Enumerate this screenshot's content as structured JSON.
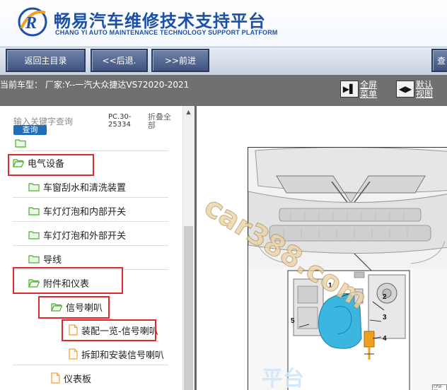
{
  "header": {
    "brand_cn": "畅易汽车维修技术支持平台",
    "brand_en": "CHANG YI AUTO MAINTENANCE TECHNOLOGY SUPPORT PLATFORM",
    "logo_icon": "cy-logo-icon"
  },
  "toolbar": {
    "home_label": "返回主目录",
    "back_label": "<<后退.",
    "forward_label": ">>前进",
    "query_label": "查"
  },
  "infobar": {
    "current_model": "当前车型： 厂家:Y--一汽大众捷达VS72020-2021",
    "fullscreen_label": "全屏菜单",
    "default_view_label": "默认视图"
  },
  "sidebar": {
    "search_label": "输入关键字查询",
    "search_button": "查询",
    "pc_code": "PC.30-25334",
    "fold_all": "折叠全部",
    "items": [
      {
        "label": "电气设备",
        "icon": "folder-icon"
      },
      {
        "label": "车窗刮水和清洗装置",
        "icon": "folder-icon"
      },
      {
        "label": "车灯灯泡和内部开关",
        "icon": "folder-icon"
      },
      {
        "label": "车灯灯泡和外部开关",
        "icon": "folder-icon"
      },
      {
        "label": "导线",
        "icon": "folder-icon"
      },
      {
        "label": "附件和仪表",
        "icon": "folder-icon"
      },
      {
        "label": "信号喇叭",
        "icon": "folder-icon"
      },
      {
        "label": "装配一览-信号喇叭",
        "icon": "document-icon"
      },
      {
        "label": "拆卸和安装信号喇叭",
        "icon": "document-icon"
      },
      {
        "label": "仪表板",
        "icon": "document-icon"
      }
    ]
  },
  "diagram": {
    "watermark": "car388.com",
    "watermark2": "平台",
    "callouts": [
      "1",
      "2",
      "3",
      "4",
      "5"
    ],
    "code": "CFW-20"
  },
  "colors": {
    "brand_blue": "#1c4fa6",
    "toolbar_button": "#4a5f8a",
    "highlight_red": "#e0282e",
    "folder_green": "#4caf32",
    "document_orange": "#f0a040",
    "horn_cyan": "#3bb6e0"
  }
}
